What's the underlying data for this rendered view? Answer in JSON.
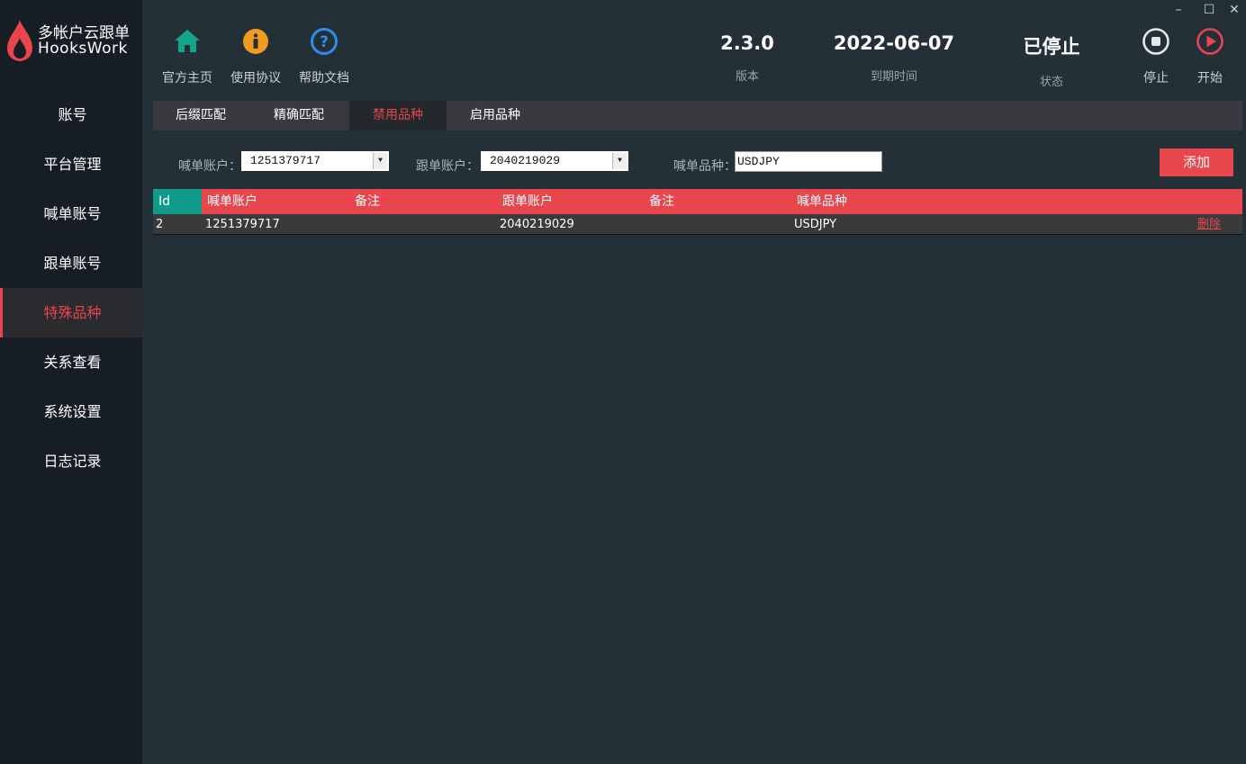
{
  "app": {
    "title_line1": "多帐户云跟单",
    "title_line2": "HooksWork"
  },
  "sidebar": {
    "items": [
      {
        "label": "账号"
      },
      {
        "label": "平台管理"
      },
      {
        "label": "喊单账号"
      },
      {
        "label": "跟单账号"
      },
      {
        "label": "特殊品种"
      },
      {
        "label": "关系查看"
      },
      {
        "label": "系统设置"
      },
      {
        "label": "日志记录"
      }
    ],
    "active": "特殊品种"
  },
  "header": {
    "home_label": "官方主页",
    "agreement_label": "使用协议",
    "help_label": "帮助文档",
    "version": {
      "value": "2.3.0",
      "caption": "版本"
    },
    "expiry": {
      "value": "2022-06-07",
      "caption": "到期时间"
    },
    "status": {
      "value": "已停止",
      "caption": "状态"
    },
    "stop_label": "停止",
    "start_label": "开始"
  },
  "window_controls": {
    "minimize": "–",
    "maximize": "☐",
    "close": "✕"
  },
  "subtabs": [
    {
      "label": "后缀匹配"
    },
    {
      "label": "精确匹配"
    },
    {
      "label": "禁用品种"
    },
    {
      "label": "启用品种"
    }
  ],
  "form": {
    "caller_account_label": "喊单账户：",
    "caller_account_value": "1251379717",
    "follower_account_label": "跟单账户：",
    "follower_account_value": "2040219029",
    "symbol_label": "喊单品种：",
    "symbol_value": "USDJPY",
    "add_label": "添加"
  },
  "table": {
    "columns": [
      "Id",
      "喊单账户",
      "备注",
      "跟单账户",
      "备注",
      "喊单品种"
    ],
    "rows": [
      {
        "id": "2",
        "caller": "1251379717",
        "caller_note": "",
        "follower": "2040219029",
        "follower_note": "",
        "symbol": "USDJPY",
        "action": "删除"
      }
    ]
  },
  "colors": {
    "accent": "#e8454d",
    "teal": "#109a8a",
    "home_icon": "#14a38b",
    "agreement_icon": "#f29a1f",
    "help_icon": "#2f8ee8"
  },
  "icons": {
    "home": "home-icon",
    "agreement": "info-icon",
    "help": "question-icon",
    "stop": "stop-icon",
    "start": "play-icon"
  }
}
